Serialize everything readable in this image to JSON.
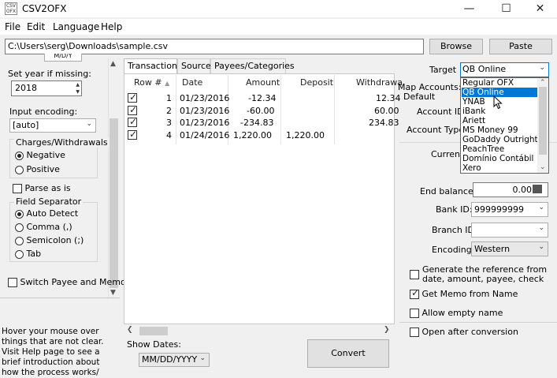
{
  "window": {
    "title": "CSV2OFX",
    "icon_text": "CSV OFX",
    "min_icon": "minimize-icon",
    "max_icon": "maximize-icon",
    "close_icon": "close-icon"
  },
  "menu": [
    "File",
    "Edit",
    "Language",
    "Help"
  ],
  "path": {
    "value": "C:\\Users\\serg\\Downloads\\sample.csv",
    "browse_label": "Browse",
    "paste_label": "Paste"
  },
  "left": {
    "format_partial": "M/D/Y",
    "set_year_label": "Set year if missing:",
    "year_value": "2018",
    "input_encoding_label": "Input encoding:",
    "input_encoding_value": "[auto]",
    "charges_title": "Charges/Withdrawals",
    "charges_options": [
      {
        "label": "Negative",
        "selected": true
      },
      {
        "label": "Positive",
        "selected": false
      }
    ],
    "parse_as_is_label": "Parse as is",
    "parse_as_is_checked": false,
    "field_sep_title": "Field Separator",
    "field_sep_options": [
      {
        "label": "Auto Detect",
        "selected": true
      },
      {
        "label": "Comma (,)",
        "selected": false
      },
      {
        "label": "Semicolon (;)",
        "selected": false
      },
      {
        "label": "Tab",
        "selected": false
      }
    ],
    "switch_label": "Switch Payee and Memo",
    "switch_checked": false,
    "help_text": "Hover your mouse over things that are not clear. Visit Help page to see a brief introduction about how the process works/"
  },
  "tabs": [
    {
      "label": "Transactions",
      "active": true
    },
    {
      "label": "Source",
      "active": false
    },
    {
      "label": "Payees/Categories",
      "active": false
    }
  ],
  "grid": {
    "columns": [
      "Row #",
      "Date",
      "Amount",
      "Deposit",
      "Withdrawa"
    ],
    "rows": [
      {
        "checked": true,
        "row": "1",
        "date": "01/23/2016",
        "amount": "-12.34",
        "deposit": "",
        "withdrawal": "12.34"
      },
      {
        "checked": true,
        "row": "2",
        "date": "01/23/2016",
        "amount": "-60.00",
        "deposit": "",
        "withdrawal": "60.00"
      },
      {
        "checked": true,
        "row": "3",
        "date": "01/23/2016",
        "amount": "-234.83",
        "deposit": "",
        "withdrawal": "234.83"
      },
      {
        "checked": true,
        "row": "4",
        "date": "01/24/2016",
        "amount": "1,220.00",
        "deposit": "1,220.00",
        "withdrawal": ""
      }
    ]
  },
  "bottom": {
    "show_dates_label": "Show Dates:",
    "date_format": "MM/DD/YYYY",
    "convert_label": "Convert"
  },
  "right": {
    "target_label": "Target",
    "target_value": "QB Online",
    "map_accounts_label": "Map Accounts:",
    "default_label": "Default",
    "account_id_label": "Account ID:",
    "account_type_label": "Account Type:",
    "currency_label": "Currenc",
    "target_options": [
      "Regular OFX",
      "QB Online",
      "YNAB",
      "iBank",
      "Ariett",
      "MS Money 99",
      "GoDaddy Outright",
      "PeachTree",
      "Domínio Contábil",
      "Xero"
    ],
    "target_selected_index": 1,
    "end_balance_label": "End balance:",
    "end_balance_value": "0.00",
    "bank_id_label": "Bank ID:",
    "bank_id_value": "999999999",
    "branch_id_label": "Branch ID",
    "branch_id_value": "",
    "encoding_label": "Encoding:",
    "encoding_value": "Western",
    "gen_ref_label": "Generate the reference from date, amount, payee, check",
    "gen_ref_checked": false,
    "memo_label": "Get Memo from Name",
    "memo_checked": true,
    "allow_empty_label": "Allow empty name",
    "allow_empty_checked": false,
    "open_after_label": "Open after conversion",
    "open_after_checked": false
  }
}
